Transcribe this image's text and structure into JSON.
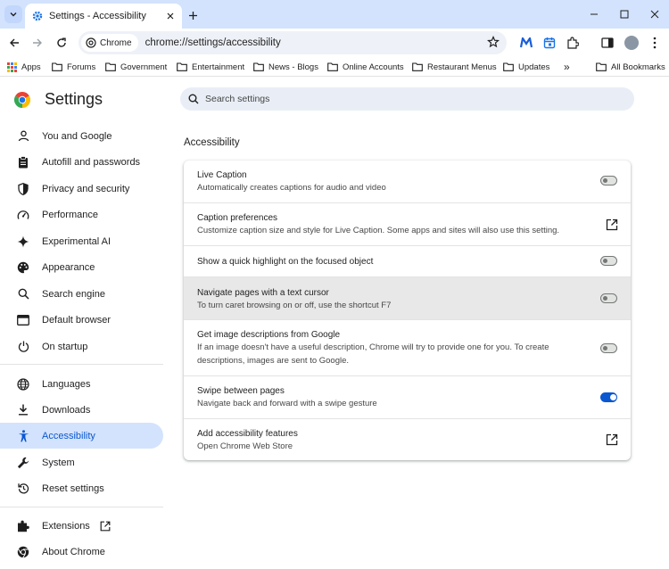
{
  "browser": {
    "tab_title": "Settings - Accessibility",
    "chip_label": "Chrome",
    "url": "chrome://settings/accessibility"
  },
  "bookmarks": {
    "items": [
      "Apps",
      "Forums",
      "Government",
      "Entertainment",
      "News - Blogs",
      "Online Accounts",
      "Restaurant Menus",
      "Updates"
    ],
    "overflow": "»",
    "all_bookmarks": "All Bookmarks"
  },
  "settings": {
    "title": "Settings",
    "search_placeholder": "Search settings"
  },
  "sidebar": {
    "items": [
      {
        "label": "You and Google",
        "icon": "person-icon"
      },
      {
        "label": "Autofill and passwords",
        "icon": "clipboard-icon"
      },
      {
        "label": "Privacy and security",
        "icon": "shield-icon"
      },
      {
        "label": "Performance",
        "icon": "speedometer-icon"
      },
      {
        "label": "Experimental AI",
        "icon": "sparkle-icon"
      },
      {
        "label": "Appearance",
        "icon": "palette-icon"
      },
      {
        "label": "Search engine",
        "icon": "search-icon"
      },
      {
        "label": "Default browser",
        "icon": "browser-window-icon"
      },
      {
        "label": "On startup",
        "icon": "power-icon"
      },
      {
        "label": "Languages",
        "icon": "globe-icon"
      },
      {
        "label": "Downloads",
        "icon": "download-icon"
      },
      {
        "label": "Accessibility",
        "icon": "accessibility-icon"
      },
      {
        "label": "System",
        "icon": "wrench-icon"
      },
      {
        "label": "Reset settings",
        "icon": "reset-icon"
      },
      {
        "label": "Extensions",
        "icon": "puzzle-icon"
      },
      {
        "label": "About Chrome",
        "icon": "chrome-logo-icon"
      }
    ],
    "active_index": 11
  },
  "main": {
    "section_title": "Accessibility",
    "rows": [
      {
        "title": "Live Caption",
        "subtitle": "Automatically creates captions for audio and video",
        "control": "toggle",
        "on": false
      },
      {
        "title": "Caption preferences",
        "subtitle": "Customize caption size and style for Live Caption. Some apps and sites will also use this setting.",
        "control": "external-link"
      },
      {
        "title": "Show a quick highlight on the focused object",
        "subtitle": "",
        "control": "toggle",
        "on": false
      },
      {
        "title": "Navigate pages with a text cursor",
        "subtitle": "To turn caret browsing on or off, use the shortcut F7",
        "control": "toggle",
        "on": false,
        "highlighted": true
      },
      {
        "title": "Get image descriptions from Google",
        "subtitle": "If an image doesn't have a useful description, Chrome will try to provide one for you. To create descriptions, images are sent to Google.",
        "control": "toggle",
        "on": false
      },
      {
        "title": "Swipe between pages",
        "subtitle": "Navigate back and forward with a swipe gesture",
        "control": "toggle",
        "on": true
      },
      {
        "title": "Add accessibility features",
        "subtitle": "Open Chrome Web Store",
        "control": "external-link"
      }
    ]
  },
  "colors": {
    "accent": "#0b57d0",
    "active_nav_bg": "#d3e3fd",
    "tabstrip_bg": "#d3e3fd"
  }
}
